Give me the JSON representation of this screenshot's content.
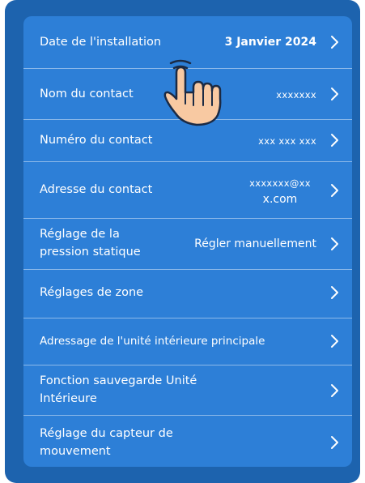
{
  "rows": [
    {
      "label": "Date de l'installation",
      "value": "3 Janvier 2024"
    },
    {
      "label": "Nom du contact",
      "value": "xxxxxxx"
    },
    {
      "label": "Numéro du contact",
      "value": "xxx xxx xxx"
    },
    {
      "label": "Adresse du contact",
      "value_line1": "xxxxxxx@xx",
      "value_line2": "x.com"
    },
    {
      "label_line1": "Réglage de la",
      "label_line2": "pression statique",
      "value": "Régler manuellement"
    },
    {
      "label": "Réglages de zone"
    },
    {
      "label": "Adressage de l'unité intérieure principale"
    },
    {
      "label_line1": "Fonction sauvegarde Unité",
      "label_line2": "Intérieure"
    },
    {
      "label_line1": "Réglage du capteur de",
      "label_line2": "mouvement"
    }
  ],
  "icons": {
    "chevron": "chevron-right-icon",
    "pointer": "hand-pointer-icon"
  },
  "colors": {
    "frame": "#1d63ae",
    "panel": "#2d7fd7",
    "text": "#ffffff",
    "hand_fill": "#f8c9a2",
    "hand_outline": "#1b2a44"
  }
}
